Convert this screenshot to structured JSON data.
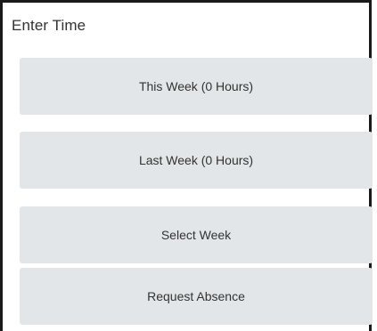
{
  "panel": {
    "title": "Enter Time"
  },
  "buttons": [
    {
      "label": "This Week (0 Hours)"
    },
    {
      "label": "Last Week (0 Hours)"
    },
    {
      "label": "Select Week"
    },
    {
      "label": "Request Absence"
    }
  ],
  "colors": {
    "button_background": "#e2e6e9",
    "text": "#333333",
    "border": "#1a1a1a"
  }
}
